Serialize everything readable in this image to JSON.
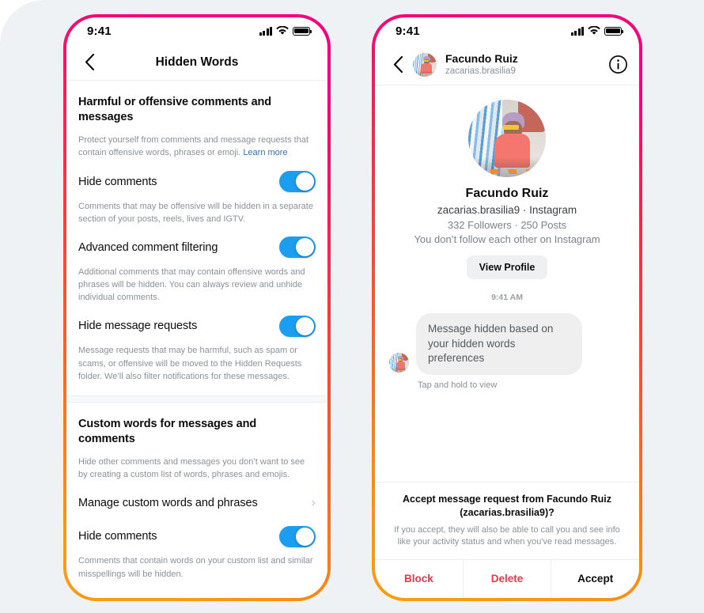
{
  "page": {
    "background_color": "#eef2f5",
    "accent_gradient_start": "#f4007e",
    "accent_gradient_end": "#fb9b12",
    "toggle_on_color": "#1b9df0",
    "link_color": "#3d6ea5",
    "danger_color": "#f0334a"
  },
  "left_phone": {
    "status_bar": {
      "time": "9:41",
      "signal_icon": "cellular-bars-icon",
      "wifi_icon": "wifi-icon",
      "battery_icon": "battery-full-icon"
    },
    "nav": {
      "back_icon": "chevron-left-icon",
      "title": "Hidden Words"
    },
    "section_harmful": {
      "title": "Harmful or offensive comments and messages",
      "description": "Protect yourself from comments and message requests that contain offensive words, phrases or emoji.",
      "learn_more": "Learn more",
      "rows": [
        {
          "label": "Hide comments",
          "control": "toggle",
          "state": "on",
          "description": "Comments that may be offensive will be hidden in a separate section of your posts, reels, lives and IGTV."
        },
        {
          "label": "Advanced comment filtering",
          "control": "toggle",
          "state": "on",
          "description": "Additional comments that may contain offensive words and phrases will be hidden. You can always review and unhide individual comments."
        },
        {
          "label": "Hide message requests",
          "control": "toggle",
          "state": "on",
          "description": "Message requests that may be harmful, such as spam or scams, or offensive will be moved to the Hidden Requests folder. We’ll also filter notifications for these messages."
        }
      ]
    },
    "section_custom": {
      "title": "Custom words for messages and comments",
      "description": "Hide other comments and messages you don’t want to see by creating a custom list of words, phrases and emojis.",
      "rows": [
        {
          "label": "Manage custom words and phrases",
          "control": "chevron",
          "chevron_icon": "chevron-right-icon"
        },
        {
          "label": "Hide comments",
          "control": "toggle",
          "state": "on",
          "description": "Comments that contain words on your custom list and similar misspellings will be hidden."
        }
      ]
    }
  },
  "right_phone": {
    "status_bar": {
      "time": "9:41",
      "signal_icon": "cellular-bars-icon",
      "wifi_icon": "wifi-icon",
      "battery_icon": "battery-full-icon"
    },
    "nav": {
      "back_icon": "chevron-left-icon",
      "avatar_icon": "user-avatar",
      "name": "Facundo Ruiz",
      "handle": "zacarias.brasilia9",
      "info_icon": "info-circle-icon"
    },
    "profile": {
      "avatar_icon": "user-avatar-large",
      "name": "Facundo Ruiz",
      "subtitle": "zacarias.brasilia9 · Instagram",
      "stats": "332 Followers · 250 Posts",
      "relationship": "You don’t follow each other on Instagram",
      "view_profile_label": "View Profile"
    },
    "conversation": {
      "timestamp": "9:41 AM",
      "message": {
        "avatar_icon": "user-avatar-small",
        "text": "Message hidden based on your hidden words preferences",
        "hint": "Tap and hold to view"
      }
    },
    "request_panel": {
      "title": "Accept message request from Facundo Ruiz (zacarias.brasilia9)?",
      "description": "If you accept, they will also be able to call you and see info like your activity status and when you've read messages.",
      "actions": [
        {
          "label": "Block",
          "style": "danger"
        },
        {
          "label": "Delete",
          "style": "danger"
        },
        {
          "label": "Accept",
          "style": "plain"
        }
      ]
    }
  }
}
